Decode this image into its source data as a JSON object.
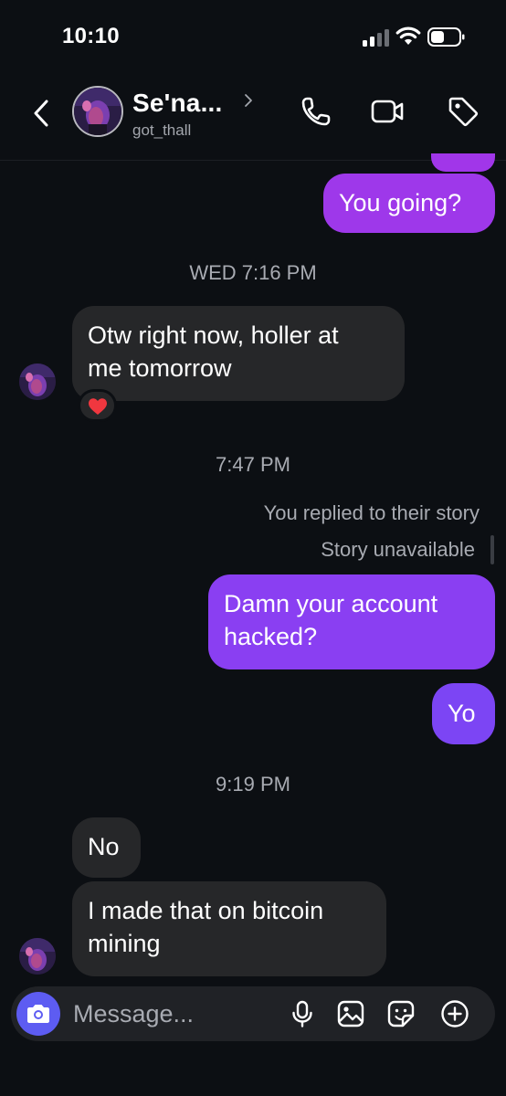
{
  "status_bar": {
    "time": "10:10"
  },
  "header": {
    "contact_name": "Se'na...",
    "username": "got_thall"
  },
  "messages": {
    "out_going": "You going?",
    "ts_wed": "WED 7:16 PM",
    "in_otw": "Otw right now, holler at me tomorrow",
    "in_otw_line1": "Otw right now, holler at",
    "in_otw_line2": "me tomorrow",
    "reaction": "❤️",
    "ts_747": "7:47 PM",
    "story_reply_note": "You replied to their story",
    "story_unavailable": "Story unavailable",
    "out_damn_line1": "Damn your account",
    "out_damn_line2": "hacked?",
    "out_yo": "Yo",
    "ts_919": "9:19 PM",
    "in_no": "No",
    "in_bitcoin_line1": "I made that on bitcoin",
    "in_bitcoin_line2": "mining"
  },
  "composer": {
    "placeholder": "Message..."
  },
  "colors": {
    "background": "#0c0f13",
    "incoming_bubble": "#262729",
    "outgoing_purple_top": "#a136e9",
    "outgoing_purple_mid": "#8a3ff2",
    "outgoing_violet": "#7c45f4",
    "camera_button": "#5d5cf2",
    "muted_text": "#a8abb2"
  }
}
